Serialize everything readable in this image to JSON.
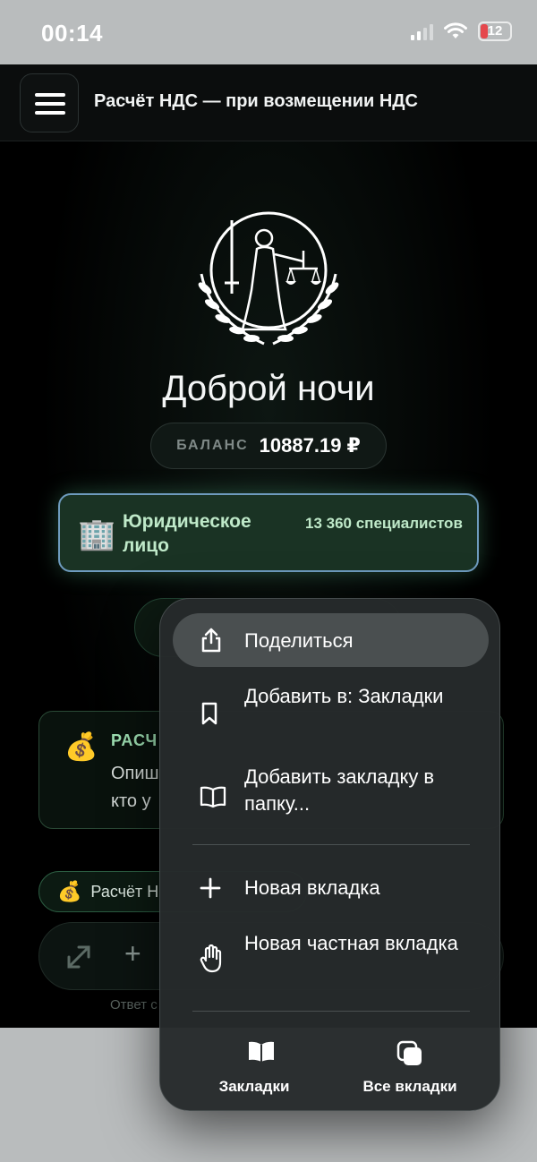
{
  "status_bar": {
    "time": "00:14",
    "battery": "12"
  },
  "header": {
    "title": "Расчёт НДС — при возмещении НДС"
  },
  "main": {
    "greeting": "Доброй ночи",
    "balance": {
      "label": "БАЛАНС",
      "value": "10887.19 ₽"
    },
    "entity": {
      "name": "Юридическое лицо",
      "count": "13 360 специалистов"
    },
    "info_card": {
      "title": "РАСЧ",
      "text": "Опиш\nкто у"
    },
    "chip": {
      "label": "Расчёт Н"
    },
    "answer_note": "Ответ с"
  },
  "context_menu": {
    "items": [
      {
        "label": "Поделиться",
        "icon": "share-icon"
      },
      {
        "label": "Добавить в: Закладки",
        "icon": "bookmark-icon"
      },
      {
        "label": "Добавить закладку в папку...",
        "icon": "book-icon"
      },
      {
        "label": "Новая вкладка",
        "icon": "plus-icon"
      },
      {
        "label": "Новая частная вкладка",
        "icon": "hand-icon"
      }
    ],
    "footer": [
      {
        "label": "Закладки",
        "icon": "book-filled-icon"
      },
      {
        "label": "Все вкладки",
        "icon": "tabs-icon"
      }
    ]
  },
  "colors": {
    "accent_green": "#bfe9c9",
    "card_border": "#6e9bbe",
    "battery_low": "#e5484d"
  }
}
